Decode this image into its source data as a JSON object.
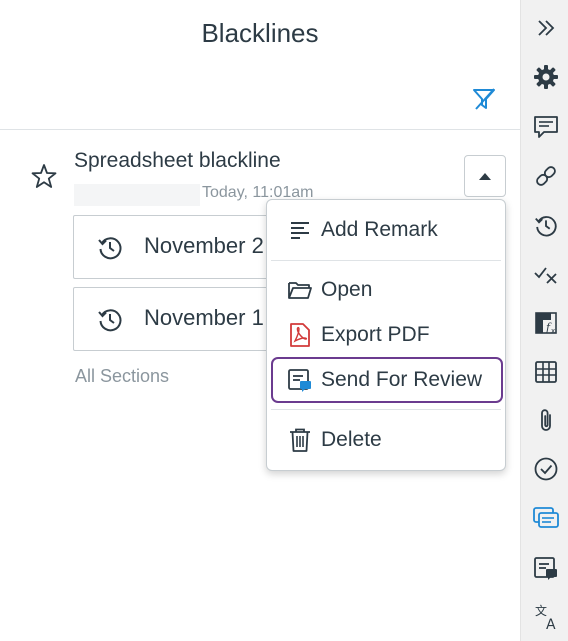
{
  "panel": {
    "title": "Blacklines"
  },
  "item": {
    "title": "Spreadsheet blackline",
    "timestamp": "Today, 11:01am",
    "versions": [
      {
        "label": "November 2"
      },
      {
        "label": "November 1"
      }
    ],
    "all_sections": "All Sections"
  },
  "menu": {
    "add_remark": "Add Remark",
    "open": "Open",
    "export_pdf": "Export PDF",
    "send_for_review": "Send For Review",
    "delete": "Delete"
  },
  "rail": {
    "icons": [
      "collapse-icon",
      "settings-icon",
      "comment-icon",
      "link-icon",
      "history-icon",
      "tickmark-icon",
      "formula-icon",
      "table-icon",
      "attachment-icon",
      "task-check-icon",
      "blacklines-icon",
      "review-icon",
      "translate-icon"
    ]
  },
  "colors": {
    "accent_blue": "#1f8ad6",
    "highlight_purple": "#6b3b8f",
    "pdf_red": "#d23a3a",
    "text": "#2d3b45",
    "muted": "#8b969e"
  }
}
